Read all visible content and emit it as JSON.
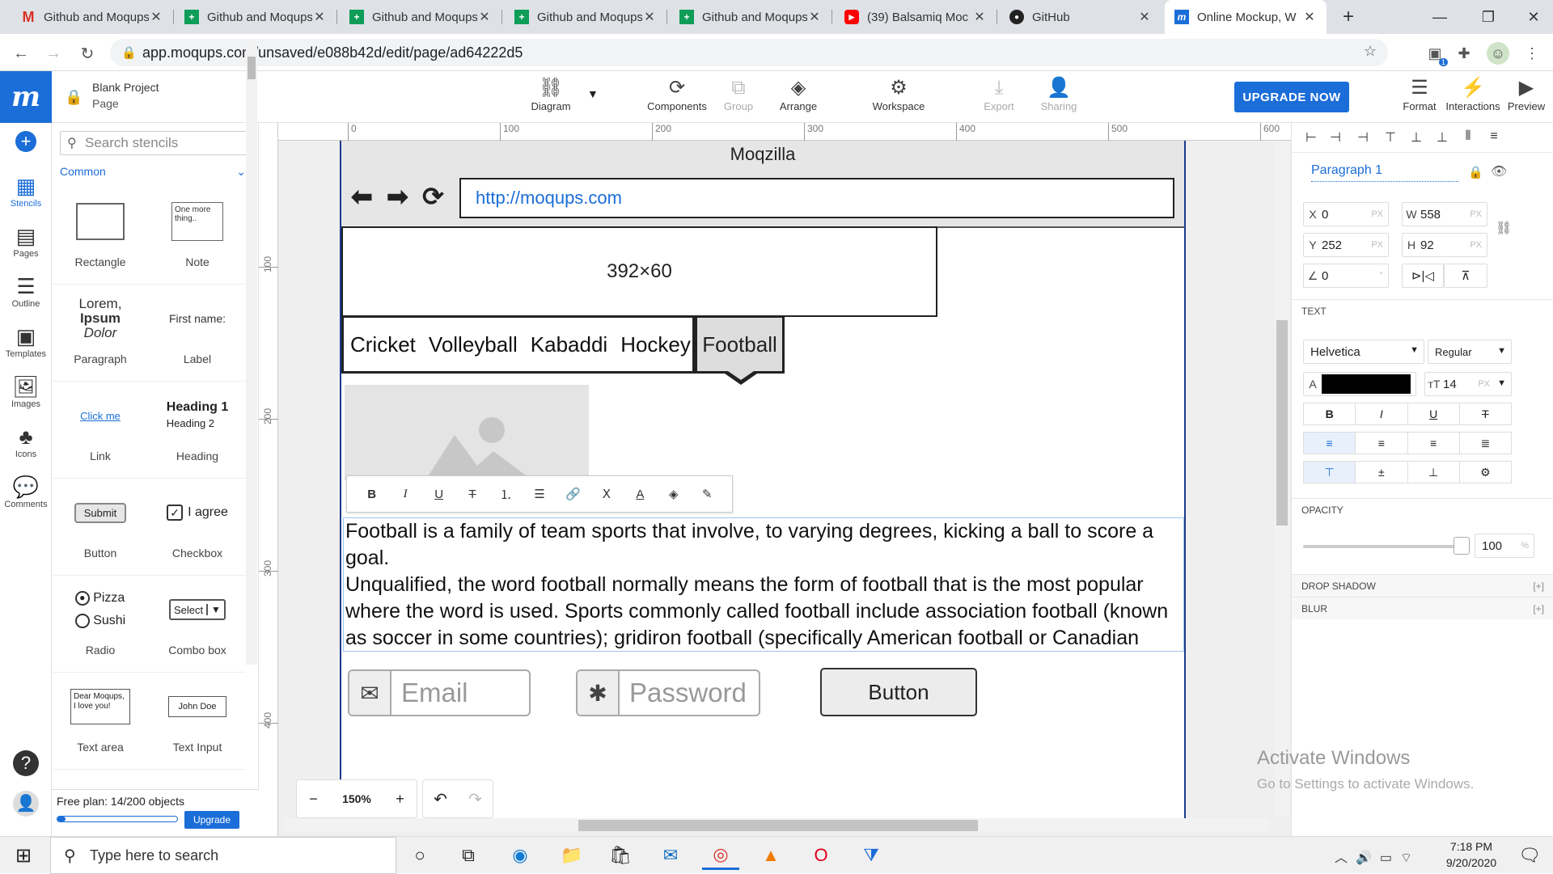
{
  "browser": {
    "tabs": [
      {
        "title": "Github and Moqups",
        "icon": "gmail-icon"
      },
      {
        "title": "Github and Moqups",
        "icon": "sheets-icon"
      },
      {
        "title": "Github and Moqups",
        "icon": "sheets-icon"
      },
      {
        "title": "Github and Moqups",
        "icon": "sheets-icon"
      },
      {
        "title": "Github and Moqups",
        "icon": "sheets-icon"
      },
      {
        "title": "(39) Balsamiq Moc",
        "icon": "youtube-icon"
      },
      {
        "title": "GitHub",
        "icon": "github-icon"
      },
      {
        "title": "Online Mockup, W",
        "icon": "moqups-icon"
      }
    ],
    "new_tab": "+",
    "url": "app.moqups.com/unsaved/e088b42d/edit/page/ad64222d5",
    "extension_badge": "1"
  },
  "app": {
    "logo": "m",
    "project": "Blank Project",
    "page": "Page",
    "toolbar": {
      "diagram": "Diagram",
      "components": "Components",
      "group": "Group",
      "arrange": "Arrange",
      "workspace": "Workspace",
      "export": "Export",
      "sharing": "Sharing",
      "upgrade": "UPGRADE NOW",
      "format": "Format",
      "interactions": "Interactions",
      "preview": "Preview"
    },
    "rail": {
      "stencils": "Stencils",
      "pages": "Pages",
      "outline": "Outline",
      "templates": "Templates",
      "images": "Images",
      "icons": "Icons",
      "comments": "Comments"
    },
    "stencils": {
      "search_placeholder": "Search stencils",
      "category": "Common",
      "items": {
        "rectangle": "Rectangle",
        "note": "Note",
        "note_preview": "One more thing..",
        "paragraph": "Paragraph",
        "para_l1": "Lorem,",
        "para_l2": "Ipsum",
        "para_l3": "Dolor",
        "label": "Label",
        "label_preview": "First name:",
        "link": "Link",
        "link_preview": "Click me",
        "heading": "Heading",
        "heading1": "Heading 1",
        "heading2": "Heading 2",
        "button": "Button",
        "button_preview": "Submit",
        "checkbox": "Checkbox",
        "checkbox_preview": "I agree",
        "radio": "Radio",
        "radio1": "Pizza",
        "radio2": "Sushi",
        "combo": "Combo box",
        "combo_preview": "Select",
        "textarea": "Text area",
        "textarea_preview": "Dear Moqups, I love you!",
        "textinput": "Text Input",
        "textinput_preview": "John Doe"
      },
      "plan": "Free plan: 14/200 objects",
      "plan_progress": 0.07,
      "upgrade": "Upgrade"
    },
    "ruler_top": [
      "0",
      "100",
      "200",
      "300",
      "400",
      "500",
      "600"
    ],
    "ruler_left": [
      "100",
      "200",
      "300",
      "400"
    ],
    "zoom": "150%",
    "zoom_minus": "−",
    "zoom_plus": "+"
  },
  "mockup": {
    "title": "Moqzilla",
    "url": "http://moqups.com",
    "placeholder": "392×60",
    "tabs": [
      "Cricket",
      "Volleyball",
      "Kabaddi",
      "Hockey"
    ],
    "active_tab": "Football",
    "paragraph": "Football is a family of team sports that involve, to varying degrees, kicking a ball to score a goal.\nUnqualified, the word football normally means the form of football that is the most popular where the word is used. Sports commonly called football include association football (known as soccer in some countries); gridiron football (specifically American football or Canadian football)",
    "email_placeholder": "Email",
    "password_placeholder": "Password",
    "button": "Button"
  },
  "inspector": {
    "element": "Paragraph 1",
    "x": "0",
    "y": "252",
    "w": "558",
    "h": "92",
    "angle": "0",
    "x_label": "X",
    "y_label": "Y",
    "w_label": "W",
    "h_label": "H",
    "unit": "PX",
    "deg": "°",
    "text_section": "TEXT",
    "font": "Helvetica",
    "weight": "Regular",
    "font_size": "14",
    "color_label": "A",
    "text_color": "#000000",
    "opacity_section": "OPACITY",
    "opacity": "100",
    "opacity_unit": "%",
    "drop_shadow": "DROP SHADOW",
    "blur": "BLUR",
    "expand": "[+]"
  },
  "watermark": {
    "title": "Activate Windows",
    "sub": "Go to Settings to activate Windows."
  },
  "taskbar": {
    "search": "Type here to search",
    "time": "7:18 PM",
    "date": "9/20/2020"
  }
}
